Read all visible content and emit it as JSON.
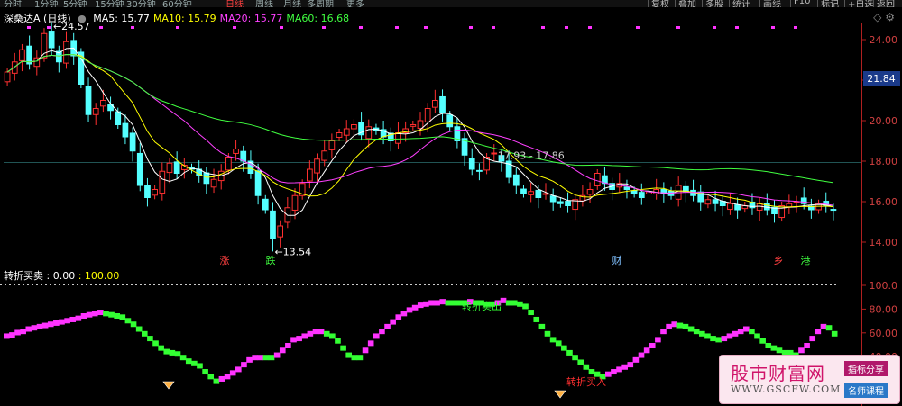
{
  "periods": [
    {
      "label": "分时",
      "active": false
    },
    {
      "label": "1分钟",
      "active": false
    },
    {
      "label": "5分钟",
      "active": false
    },
    {
      "label": "15分钟",
      "active": false
    },
    {
      "label": "30分钟",
      "active": false
    },
    {
      "label": "60分钟",
      "active": false
    },
    {
      "label": "日线",
      "active": true
    },
    {
      "label": "周线",
      "active": false
    },
    {
      "label": "月线",
      "active": false
    },
    {
      "label": "多周期",
      "active": false
    },
    {
      "label": "更多",
      "active": false
    }
  ],
  "toolbar": [
    "复权",
    "叠加",
    "多股",
    "统计",
    "画线",
    "F10",
    "标记",
    "+自选",
    "返回"
  ],
  "stock": {
    "title": "深桑达A (日线)",
    "ma": [
      {
        "label": "MA5: 15.77",
        "color": "#ffffff"
      },
      {
        "label": "MA10: 15.79",
        "color": "#ffff00"
      },
      {
        "label": "MA20: 15.77",
        "color": "#ff40ff"
      },
      {
        "label": "MA60: 16.68",
        "color": "#40ff40"
      }
    ]
  },
  "indicator": {
    "title": "转折买卖",
    "value1": ": 0.00",
    "value2": ": 100.00",
    "sell_label": "转折卖出",
    "buy_label": "转折买入"
  },
  "annotations": {
    "high": "24.57",
    "low": "13.54",
    "range": "17.93 - 17.86",
    "current": "21.84"
  },
  "price_axis": [
    "24.00",
    "22.00",
    "20.00",
    "18.00",
    "16.00",
    "14.00"
  ],
  "ind_axis": [
    "100.0",
    "80.00",
    "60.00",
    "40.00"
  ],
  "events": [
    {
      "label": "涨",
      "color": "#ff4040"
    },
    {
      "label": "跌",
      "color": "#40ff40"
    },
    {
      "label": "财",
      "color": "#80c0ff"
    },
    {
      "label": "乡",
      "color": "#ff4040"
    },
    {
      "label": "港",
      "color": "#40ff40"
    }
  ],
  "watermark": {
    "title": "股市财富网",
    "url": "WWW.GSCFW.COM",
    "tag1": "指标分享",
    "tag2": "名师课程"
  },
  "colors": {
    "up": "#ff3030",
    "down": "#54ffff",
    "ma5": "#ffffff",
    "ma10": "#ffff00",
    "ma20": "#ff40ff",
    "ma60": "#40ff40",
    "ind_up": "#ff33ff",
    "ind_down": "#33ff33",
    "grid": "#b02020"
  },
  "series": {
    "close": [
      22.4,
      22.9,
      23.5,
      22.8,
      23.1,
      24.3,
      23.6,
      22.9,
      23.9,
      23.2,
      21.8,
      20.3,
      20.6,
      21.0,
      20.5,
      19.8,
      19.2,
      18.5,
      16.8,
      16.2,
      16.6,
      17.5,
      17.9,
      17.4,
      17.8,
      17.6,
      17.3,
      16.9,
      17.1,
      17.5,
      18.2,
      18.6,
      18.0,
      17.4,
      16.3,
      15.6,
      14.2,
      14.8,
      15.7,
      16.3,
      16.9,
      17.6,
      18.1,
      18.5,
      19.0,
      19.4,
      19.6,
      19.8,
      19.3,
      19.7,
      19.5,
      19.2,
      19.0,
      19.4,
      19.6,
      19.8,
      20.0,
      20.6,
      21.0,
      20.4,
      19.7,
      19.0,
      18.3,
      17.6,
      17.5,
      18.2,
      18.4,
      18.0,
      17.2,
      16.8,
      16.4,
      16.5,
      16.2,
      16.4,
      16.0,
      15.9,
      15.8,
      16.1,
      16.3,
      16.6,
      17.4,
      16.9,
      16.6,
      16.9,
      16.6,
      16.4,
      16.2,
      16.5,
      16.6,
      16.4,
      16.3,
      16.8,
      16.5,
      16.3,
      16.0,
      16.1,
      15.9,
      15.8,
      15.9,
      15.6,
      15.8,
      15.7,
      15.9,
      15.6,
      15.4,
      15.8,
      15.9,
      16.0,
      15.9,
      15.6,
      15.9,
      15.8,
      15.6
    ],
    "indicator": [
      58,
      59,
      61,
      62,
      64,
      65,
      66,
      67,
      68,
      69,
      70,
      71,
      72,
      73,
      75,
      76,
      77,
      78,
      77,
      76,
      75,
      74,
      71,
      68,
      64,
      60,
      56,
      52,
      48,
      45,
      44,
      43,
      40,
      37,
      35,
      33,
      28,
      24,
      20,
      22,
      24,
      27,
      30,
      34,
      38,
      40,
      40,
      40,
      40,
      42,
      46,
      50,
      55,
      56,
      58,
      60,
      62,
      62,
      60,
      58,
      54,
      48,
      42,
      40,
      40,
      46,
      52,
      58,
      62,
      66,
      70,
      74,
      77,
      80,
      82,
      84,
      85,
      86,
      86,
      87,
      86,
      86,
      86,
      86,
      87,
      86,
      86,
      85,
      85,
      86,
      88,
      86,
      86,
      85,
      83,
      78,
      72,
      66,
      60,
      55,
      52,
      48,
      44,
      40,
      36,
      32,
      28,
      26,
      24,
      26,
      28,
      30,
      32,
      34,
      38,
      42,
      46,
      50,
      55,
      62,
      66,
      68,
      67,
      66,
      64,
      62,
      60,
      58,
      56,
      55,
      56,
      58,
      60,
      62,
      64,
      62,
      58,
      54,
      50,
      48,
      46,
      44,
      44,
      42,
      46,
      50,
      56,
      62,
      66,
      65,
      60
    ]
  }
}
